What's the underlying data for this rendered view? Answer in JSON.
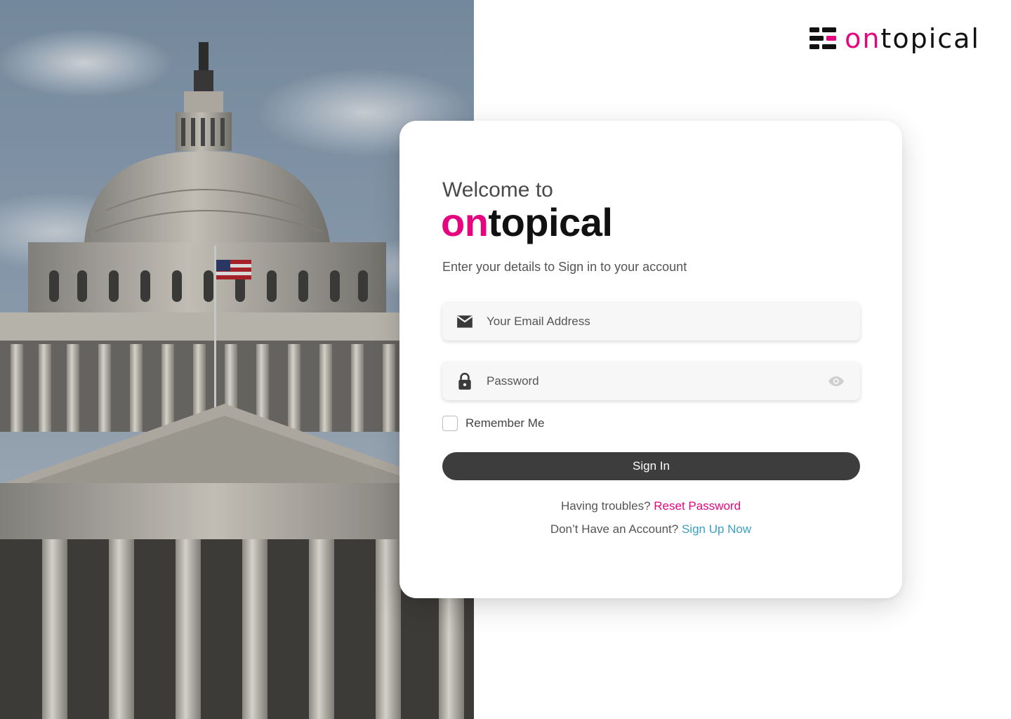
{
  "hero": {
    "image_subject": "capitol-dome-photo"
  },
  "brand": {
    "logo_icon": "ontopical-logo-icon",
    "name_accent": "on",
    "name_rest": "topical",
    "accent_color": "#e5057f"
  },
  "card": {
    "welcome": "Welcome to",
    "title_accent": "on",
    "title_rest": "topical",
    "subtitle": "Enter your details to Sign in to your account",
    "email": {
      "icon": "mail-icon",
      "placeholder": "Your Email Address",
      "value": ""
    },
    "password": {
      "icon": "lock-icon",
      "placeholder": "Password",
      "value": "",
      "toggle_icon": "eye-icon"
    },
    "remember_label": "Remember Me",
    "remember_checked": false,
    "signin_label": "Sign In",
    "trouble_text": "Having troubles?",
    "reset_link": "Reset Password",
    "signup_text": "Don’t Have an Account?",
    "signup_link": "Sign Up Now"
  },
  "colors": {
    "accent_pink": "#e5057f",
    "link_blue": "#3aa0c8",
    "button_dark": "#3d3d3d"
  }
}
